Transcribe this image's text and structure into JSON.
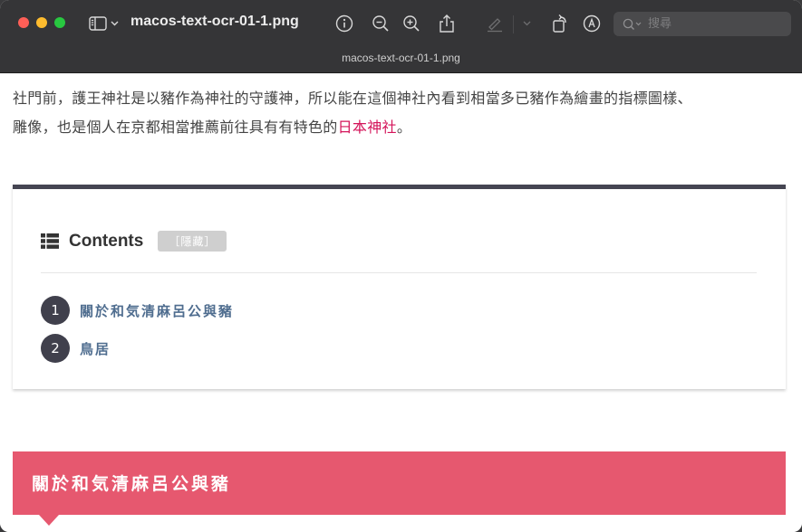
{
  "window": {
    "title": "macos-text-ocr-01-1.png",
    "doc_tab": "macos-text-ocr-01-1.png"
  },
  "toolbar": {
    "icons": [
      "sidebar-icon",
      "info-icon",
      "zoom-out-icon",
      "zoom-in-icon",
      "share-icon",
      "highlight-icon",
      "rotate-icon",
      "markup-icon"
    ],
    "search_placeholder": "搜尋"
  },
  "article": {
    "line1": "社門前，護王神社是以豬作為神社的守護神，所以能在這個神社內看到相當多已豬作為繪畫的指標圖樣、",
    "line2_prefix": "雕像，也是個人在京都相當推薦前往具有有特色的",
    "line2_link": "日本神社",
    "line2_suffix": "。",
    "link_color": "#d4145a"
  },
  "toc": {
    "title": "Contents",
    "toggle_label": "［隱藏］",
    "items": [
      {
        "num": "1",
        "label": "關於和気清麻呂公與豬"
      },
      {
        "num": "2",
        "label": "鳥居"
      }
    ]
  },
  "section": {
    "heading": "關於和気清麻呂公與豬",
    "color": "#e6586f"
  }
}
